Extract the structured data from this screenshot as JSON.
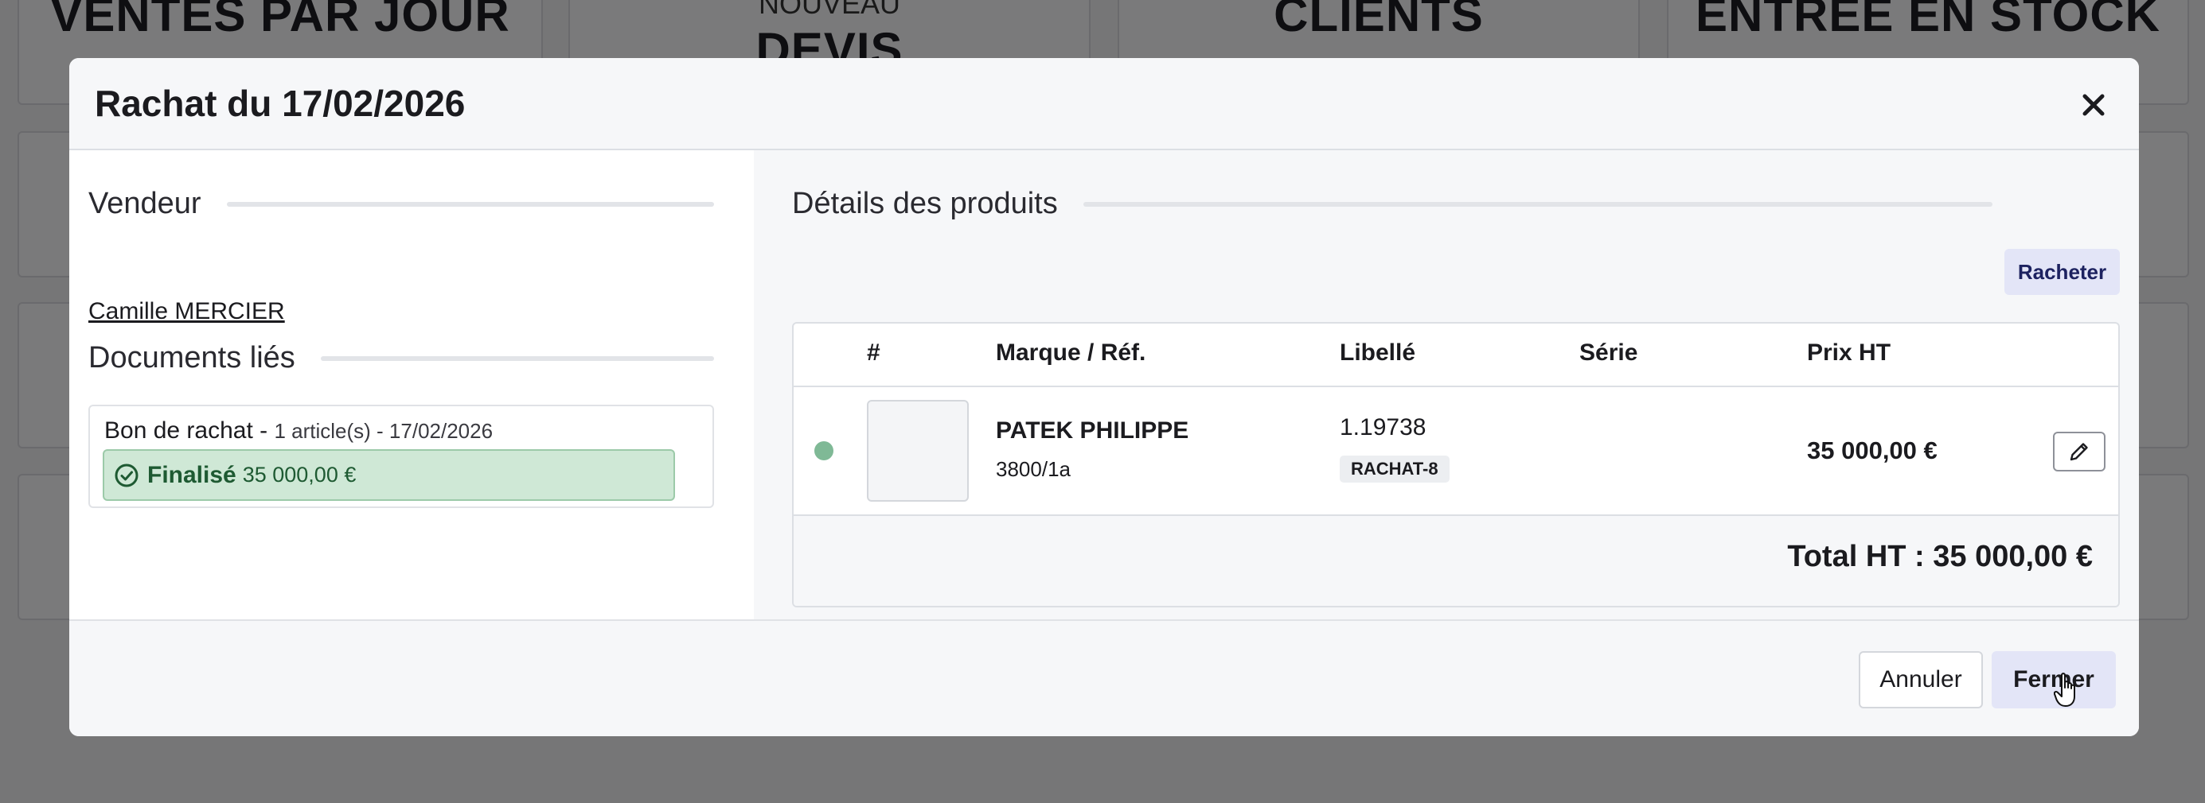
{
  "background": {
    "tiles": [
      {
        "title": "VENTES PAR JOUR",
        "subtitle": ""
      },
      {
        "title": "DEVIS",
        "subtitle": "NOUVEAU"
      },
      {
        "title": "CLIENTS",
        "subtitle": ""
      },
      {
        "title": "ENTRÉE EN STOCK",
        "subtitle": ""
      }
    ]
  },
  "modal": {
    "title": "Rachat du 17/02/2026",
    "close_icon": "close-icon"
  },
  "seller": {
    "heading": "Vendeur",
    "name": "Camille MERCIER"
  },
  "documents": {
    "heading": "Documents liés",
    "items": [
      {
        "label": "Bon de rachat -",
        "meta": "1 article(s) - 17/02/2026",
        "status": "Finalisé",
        "amount": "35 000,00 €",
        "status_color": "#cfe8d6"
      }
    ]
  },
  "products": {
    "heading": "Détails des produits",
    "action_label": "Racheter",
    "columns": [
      "#",
      "Marque / Réf.",
      "Libellé",
      "Série",
      "Prix HT"
    ],
    "rows": [
      {
        "brand": "PATEK PHILIPPE",
        "ref": "3800/1a",
        "libelle": "1.19738",
        "tag": "RACHAT-8",
        "serie": "",
        "price": "35 000,00 €",
        "dot_color": "#7fb996"
      }
    ],
    "total": "Total HT : 35 000,00 €"
  },
  "footer": {
    "cancel_label": "Annuler",
    "close_label": "Fermer"
  },
  "colors": {
    "accent_button": "#e3e5f7",
    "success": "#cfe8d6"
  }
}
